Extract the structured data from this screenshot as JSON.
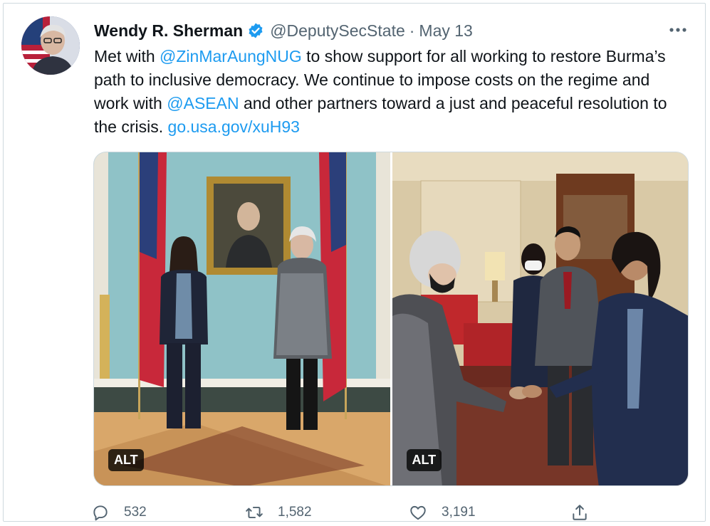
{
  "tweet": {
    "author_name": "Wendy R. Sherman",
    "handle": "@DeputySecState",
    "separator": "·",
    "date": "May 13",
    "text_1": "Met with ",
    "mention_1": "@ZinMarAungNUG",
    "text_2": " to show support for all working to restore Burma’s path to inclusive democracy. We continue to impose costs on the regime and work with ",
    "mention_2": "@ASEAN",
    "text_3": " and other partners toward a just and peaceful resolution to the crisis. ",
    "url": "go.usa.gov/xuH93"
  },
  "media": {
    "alt_label_1": "ALT",
    "alt_label_2": "ALT"
  },
  "stats": {
    "replies": "532",
    "retweets": "1,582",
    "likes": "3,191"
  },
  "colors": {
    "link": "#1d9bf0",
    "muted": "#536471",
    "verified": "#1d9bf0"
  },
  "icons": [
    "verified-badge-icon",
    "more-icon",
    "reply-icon",
    "retweet-icon",
    "like-icon",
    "share-icon"
  ]
}
